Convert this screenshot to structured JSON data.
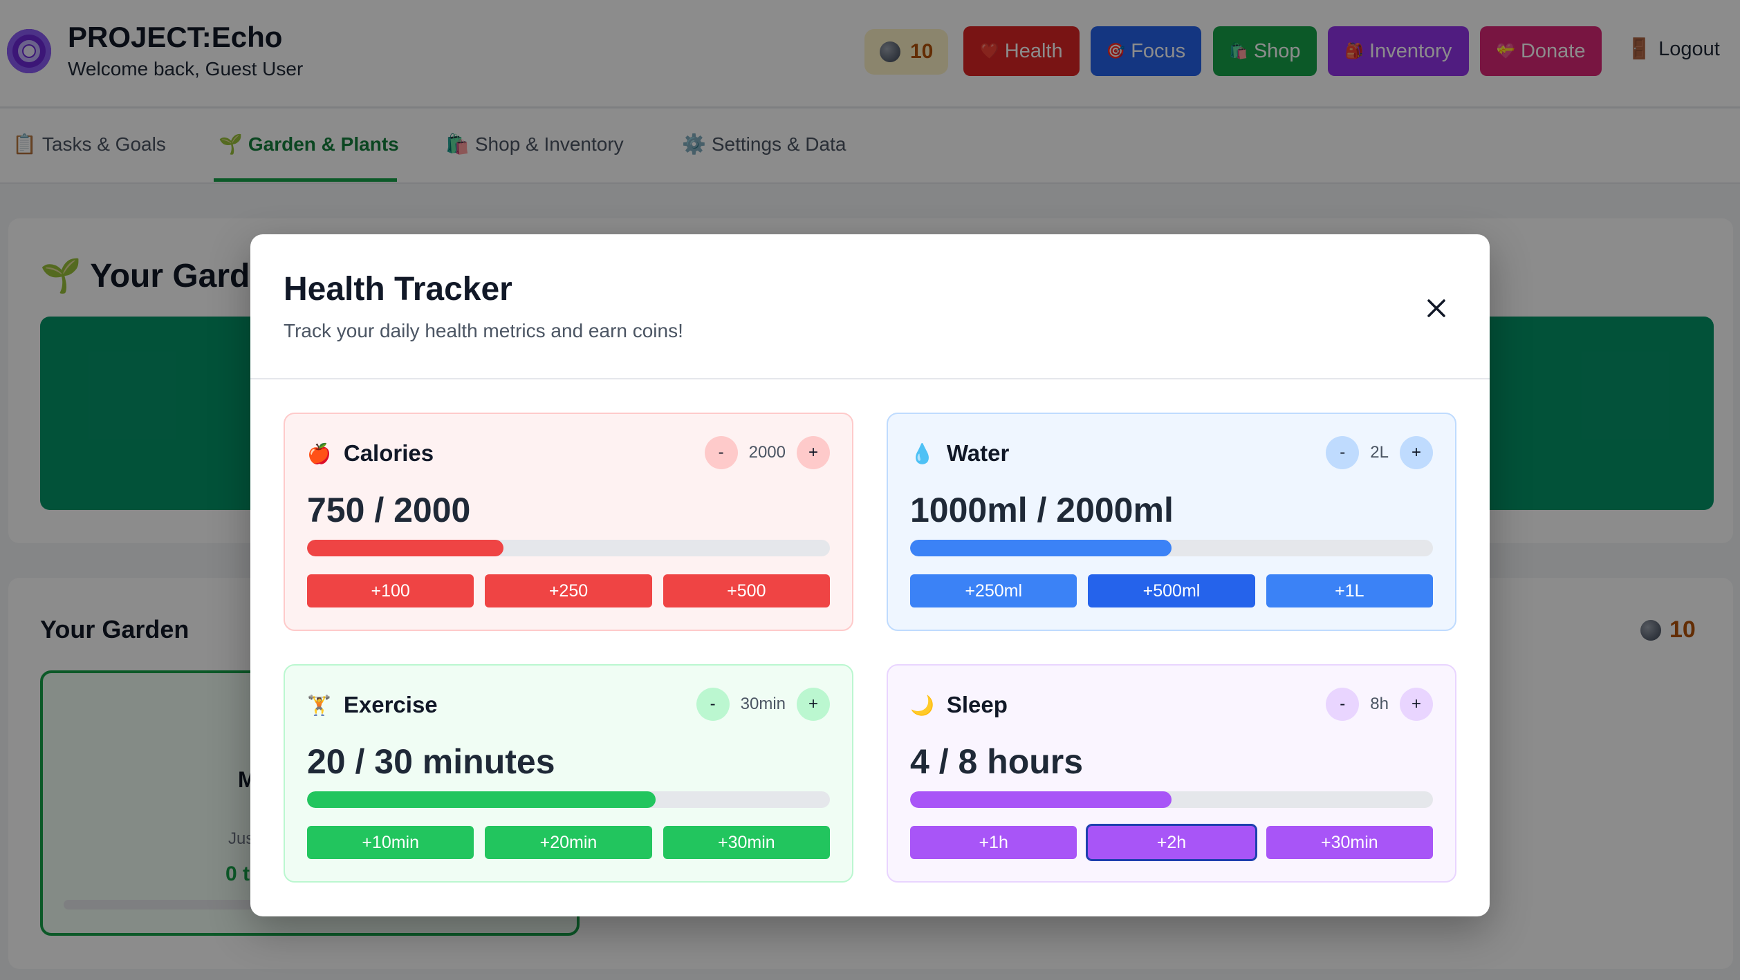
{
  "app": {
    "title": "PROJECT:Echo",
    "welcome": "Welcome back, Guest User",
    "coins": "10"
  },
  "header_buttons": {
    "health": "Health",
    "focus": "Focus",
    "shop": "Shop",
    "inventory": "Inventory",
    "donate": "Donate",
    "logout": "Logout"
  },
  "icons": {
    "health": "❤️",
    "focus": "🎯",
    "shop": "🛍️",
    "inventory": "🎒",
    "donate": "💝",
    "logout": "🚪",
    "tasks": "📋",
    "garden": "🌱",
    "shop_tab": "🛍️",
    "settings": "⚙️"
  },
  "tabs": [
    {
      "label": "Tasks & Goals"
    },
    {
      "label": "Garden & Plants"
    },
    {
      "label": "Shop & Inventory"
    },
    {
      "label": "Settings & Data"
    }
  ],
  "background": {
    "garden_heading": "Your Garden",
    "garden_section_heading": "Your Garden",
    "coins": "10",
    "plant_name": "M",
    "plant_sub": "Jus",
    "plant_count": "0 t"
  },
  "modal": {
    "title": "Health Tracker",
    "subtitle": "Track your daily health metrics and earn coins!"
  },
  "metrics": {
    "calories": {
      "label": "Calories",
      "goal": "2000",
      "value": "750 / 2000",
      "progress": 0.375,
      "buttons": [
        "+100",
        "+250",
        "+500"
      ]
    },
    "water": {
      "label": "Water",
      "goal": "2L",
      "value": "1000ml / 2000ml",
      "progress": 0.5,
      "buttons": [
        "+250ml",
        "+500ml",
        "+1L"
      ]
    },
    "exercise": {
      "label": "Exercise",
      "goal": "30min",
      "value": "20 / 30 minutes",
      "progress": 0.667,
      "buttons": [
        "+10min",
        "+20min",
        "+30min"
      ]
    },
    "sleep": {
      "label": "Sleep",
      "goal": "8h",
      "value": "4 / 8 hours",
      "progress": 0.5,
      "buttons": [
        "+1h",
        "+2h",
        "+30min"
      ]
    }
  },
  "colors": {
    "calories": "#ef4444",
    "water": "#3b82f6",
    "exercise": "#22c55e",
    "sleep": "#a855f7"
  }
}
